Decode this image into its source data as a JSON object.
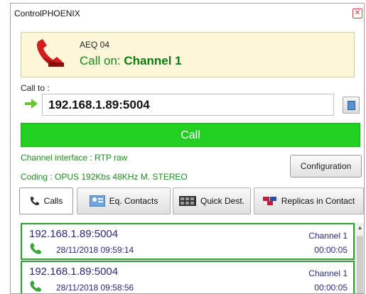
{
  "window": {
    "title": "ControlPHOENIX",
    "close_glyph": "✕"
  },
  "header": {
    "icon": "phone-handset-icon",
    "device_name": "AEQ 04",
    "call_on_prefix": "Call on: ",
    "channel": "Channel 1"
  },
  "call_to": {
    "label": "Call to :",
    "value": "192.168.1.89:5004",
    "arrow_icon": "green-arrow-icon",
    "book_icon": "address-book-icon"
  },
  "call_button": {
    "label": "Call",
    "color": "#22d022"
  },
  "channel_info": {
    "interface": "Channel interface : RTP raw",
    "coding": "Coding : OPUS 192Kbs 48KHz M. STEREO",
    "config_button": "Configuration"
  },
  "tabs": [
    {
      "label": "Calls",
      "icon": "phone-icon",
      "active": true
    },
    {
      "label": "Eq. Contacts",
      "icon": "contact-card-icon",
      "active": false
    },
    {
      "label": "Quick Dest.",
      "icon": "keypad-icon",
      "active": false
    },
    {
      "label": "Replicas in Contact",
      "icon": "replicas-icon",
      "active": false
    }
  ],
  "calls": [
    {
      "address": "192.168.1.89:5004",
      "date": "28/11/2018 09:59:14",
      "channel": "Channel 1",
      "duration": "00:00:05"
    },
    {
      "address": "192.168.1.89:5004",
      "date": "28/11/2018 09:58:56",
      "channel": "Channel 1",
      "duration": "00:00:05"
    }
  ],
  "colors": {
    "accent_green": "#22d022",
    "text_green": "#1c8c1c",
    "list_border": "#2aa12a",
    "header_bg": "#fbf7d8"
  }
}
